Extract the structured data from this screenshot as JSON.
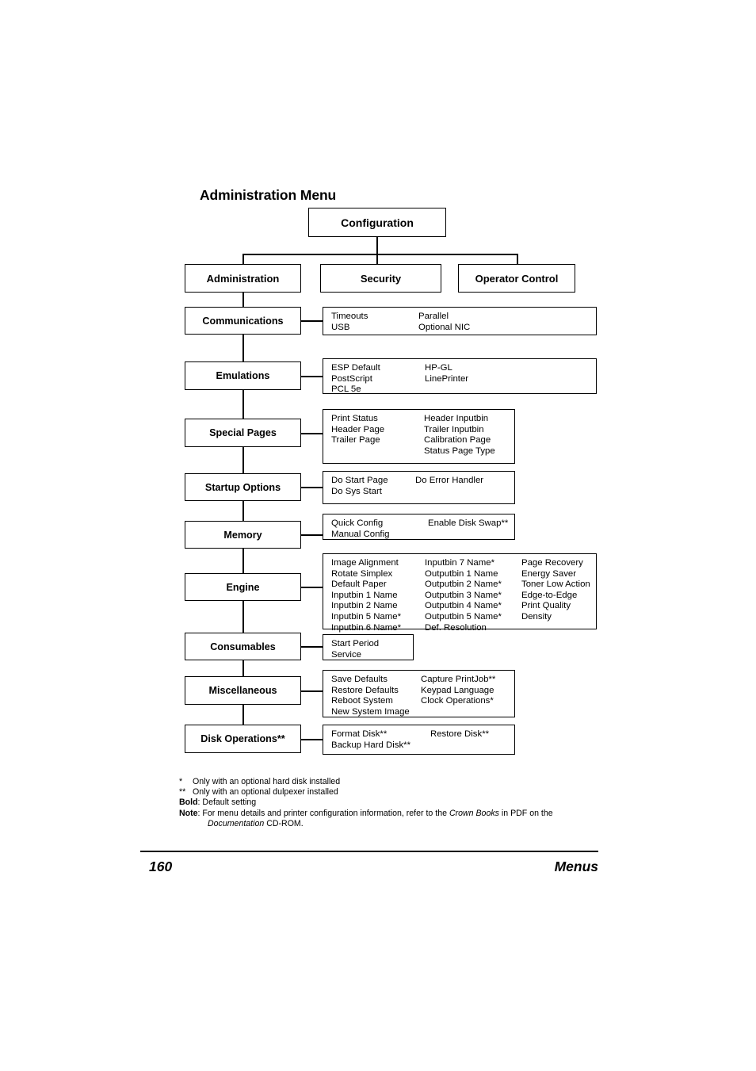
{
  "document": {
    "title": "Administration Menu"
  },
  "tree": {
    "root": {
      "label": "Configuration"
    },
    "level2": [
      {
        "label": "Administration"
      },
      {
        "label": "Security"
      },
      {
        "label": "Operator Control"
      }
    ],
    "branches": [
      {
        "label": "Communications",
        "columns": [
          [
            "Timeouts",
            "USB"
          ],
          [
            "Parallel",
            "Optional NIC"
          ]
        ]
      },
      {
        "label": "Emulations",
        "columns": [
          [
            "ESP Default",
            "PostScript",
            "PCL 5e"
          ],
          [
            "HP-GL",
            "LinePrinter"
          ]
        ]
      },
      {
        "label": "Special Pages",
        "columns": [
          [
            "Print Status",
            "Header Page",
            "Trailer Page"
          ],
          [
            "Header Inputbin",
            "Trailer Inputbin",
            "Calibration Page",
            "Status Page Type"
          ]
        ]
      },
      {
        "label": "Startup Options",
        "columns": [
          [
            "Do Start Page",
            "Do Sys Start"
          ],
          [
            "Do Error Handler"
          ]
        ]
      },
      {
        "label": "Memory",
        "columns": [
          [
            "Quick Config",
            "Manual Config"
          ],
          [
            "Enable Disk Swap**"
          ]
        ]
      },
      {
        "label": "Engine",
        "columns": [
          [
            "Image Alignment",
            "Rotate Simplex",
            "Default Paper",
            "Inputbin 1 Name",
            "Inputbin 2 Name",
            "Inputbin 5 Name*",
            "Inputbin 6 Name*"
          ],
          [
            "Inputbin 7 Name*",
            "Outputbin 1 Name",
            "Outputbin 2 Name*",
            "Outputbin 3 Name*",
            "Outputbin 4 Name*",
            "Outputbin 5 Name*",
            "Def. Resolution"
          ],
          [
            "Page Recovery",
            "Energy Saver",
            "Toner Low Action",
            "Edge-to-Edge",
            "Print Quality",
            "Density"
          ]
        ]
      },
      {
        "label": "Consumables",
        "columns": [
          [
            "Start Period",
            "Service"
          ]
        ]
      },
      {
        "label": "Miscellaneous",
        "columns": [
          [
            "Save Defaults",
            "Restore Defaults",
            "Reboot System",
            "New System Image"
          ],
          [
            "Capture PrintJob**",
            "Keypad Language",
            "Clock Operations*"
          ]
        ]
      },
      {
        "label": "Disk Operations**",
        "columns": [
          [
            "Format Disk**",
            "Backup Hard Disk**"
          ],
          [
            "Restore Disk**"
          ]
        ]
      }
    ]
  },
  "footnotes": {
    "single_star_mark": "*",
    "single_star_text": "Only with an optional hard disk installed",
    "double_star_mark": "**",
    "double_star_text": "Only with an optional dulpexer installed",
    "bold_mark": "Bold",
    "bold_text": ": Default setting",
    "note_mark": "Note",
    "note_text_1": ": For menu details and printer configuration information, refer to the ",
    "note_italic_1": "Crown Books",
    "note_text_2": " in PDF on the",
    "note_italic_2": "Documentation",
    "note_text_3": " CD-ROM."
  },
  "footer": {
    "page_number": "160",
    "section": "Menus"
  }
}
